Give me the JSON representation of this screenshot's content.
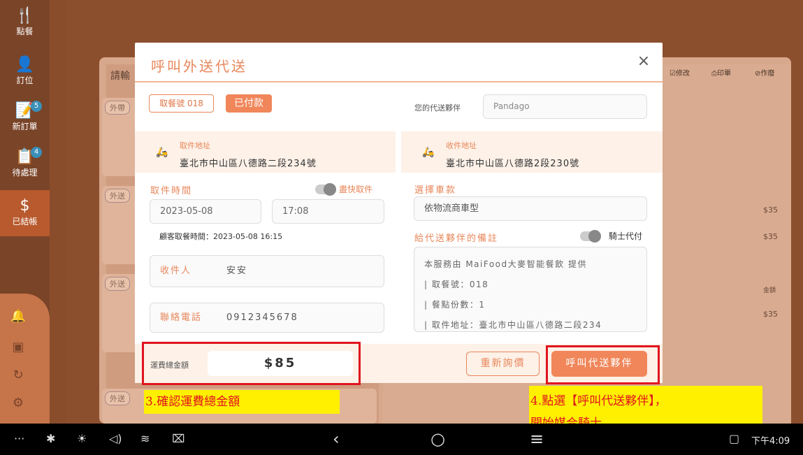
{
  "sidebar": {
    "items": [
      {
        "label": "點餐",
        "icon": "fork-knife-icon"
      },
      {
        "label": "訂位",
        "icon": "person-icon"
      },
      {
        "label": "新訂單",
        "icon": "new-order-icon",
        "badge": "5"
      },
      {
        "label": "待處理",
        "icon": "clipboard-icon",
        "badge": "4"
      },
      {
        "label": "已結帳",
        "icon": "dollar-icon"
      }
    ]
  },
  "background": {
    "search_label": "請輸",
    "toolbar": {
      "edit": "修改",
      "print": "印單",
      "void": "作廢"
    },
    "card_tags": [
      "外帶",
      "外送",
      "外送",
      "外送"
    ],
    "prices": [
      "$35",
      "$35",
      "$35"
    ],
    "amount_header": "金額"
  },
  "modal": {
    "title": "呼叫外送代送",
    "close": "×",
    "order_number": "取餐號 018",
    "paid_status": "已付款",
    "partner_label": "您的代送夥伴",
    "partner_value": "Pandago",
    "pickup_address_label": "取件地址",
    "pickup_address": "臺北市中山區八德路二段234號",
    "dropoff_address_label": "收件地址",
    "dropoff_address": "臺北市中山區八德路2段230號",
    "pickup_time_label": "取件時間",
    "asap_label": "盡快取件",
    "pickup_date": "2023-05-08",
    "pickup_time": "17:08",
    "customer_pickup_hint": "顧客取餐時間：2023-05-08 16:15",
    "vehicle_label": "選擇車款",
    "vehicle_value": "依物流商車型",
    "notes_label": "給代送夥伴的備註",
    "rider_pay_label": "騎士代付",
    "recipient_label": "收件人",
    "recipient_value": "安安",
    "phone_label": "聯絡電話",
    "phone_value": "0912345678",
    "notes_lines": [
      "本服務由 MaiFood大麥智能餐飲 提供",
      "| 取餐號：018",
      "| 餐點份數：1",
      "| 取件地址：臺北市中山區八德路二段234"
    ],
    "fee_label": "運費總金額",
    "fee_value": "$85",
    "requote_button": "重新詢價",
    "call_button": "呼叫代送夥伴"
  },
  "annotations": {
    "step3": "3.確認運費總金額",
    "step4_line1": "4.點選【呼叫代送夥伴】，",
    "step4_line2": "開始媒合騎士"
  },
  "navbar": {
    "time": "下午4:09"
  }
}
